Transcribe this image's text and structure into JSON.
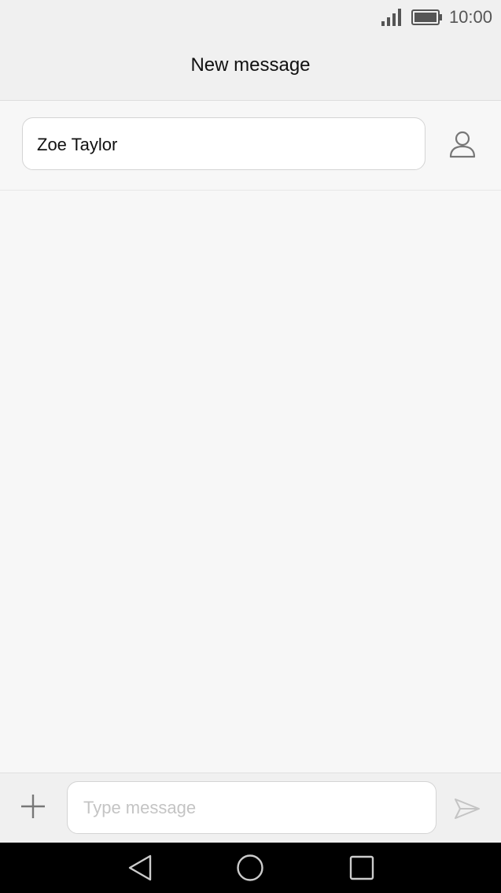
{
  "status_bar": {
    "time": "10:00",
    "signal_icon": "signal-icon",
    "battery_icon": "battery-icon"
  },
  "header": {
    "title": "New message"
  },
  "recipient": {
    "value": "Zoe Taylor",
    "contact_icon": "person-icon"
  },
  "compose": {
    "placeholder": "Type message",
    "attach_icon": "plus-icon",
    "send_icon": "send-icon"
  },
  "nav": {
    "back_icon": "back-triangle-icon",
    "home_icon": "home-circle-icon",
    "recents_icon": "recents-square-icon"
  },
  "colors": {
    "background": "#f7f7f7",
    "bar_background": "#f0f0f0",
    "icon_gray": "#777777",
    "nav_background": "#000000"
  }
}
